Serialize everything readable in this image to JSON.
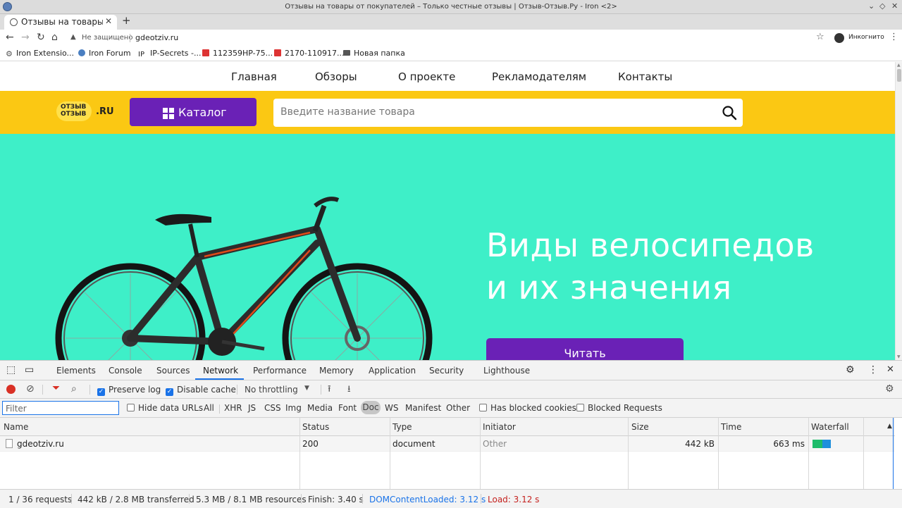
{
  "window": {
    "title": "Отзывы на товары от покупателей – Только честные отзывы | Отзыв-Отзыв.Ру - Iron <2>"
  },
  "tab": {
    "label": "Отзывы на товары от"
  },
  "addressbar": {
    "security": "Не защищено",
    "url": "gdeotziv.ru",
    "incognito": "Инкогнито"
  },
  "bookmarks": [
    "Iron Extensio...",
    "Iron Forum",
    "IP-Secrets -...",
    "112359HP-75...",
    "2170-110917...",
    "Новая папка"
  ],
  "site": {
    "nav": [
      "Главная",
      "Обзоры",
      "О проекте",
      "Рекламодателям",
      "Контакты"
    ],
    "logo_top": "ОТЗЫВ",
    "logo_bottom": "ОТЗЫВ",
    "logo_suffix": ".RU",
    "catalog_label": "Каталог",
    "search_placeholder": "Введите название товара",
    "hero_title_1": "Виды велосипедов",
    "hero_title_2": "и их значения",
    "read_button": "Читать"
  },
  "devtools": {
    "tabs": [
      "Elements",
      "Console",
      "Sources",
      "Network",
      "Performance",
      "Memory",
      "Application",
      "Security",
      "Lighthouse"
    ],
    "active_tab": "Network",
    "preserve_log": "Preserve log",
    "disable_cache": "Disable cache",
    "throttling": "No throttling",
    "filter_placeholder": "Filter",
    "hide_data_urls": "Hide data URLs",
    "type_filters": [
      "All",
      "XHR",
      "JS",
      "CSS",
      "Img",
      "Media",
      "Font",
      "Doc",
      "WS",
      "Manifest",
      "Other"
    ],
    "has_blocked_cookies": "Has blocked cookies",
    "blocked_requests": "Blocked Requests",
    "columns": [
      "Name",
      "Status",
      "Type",
      "Initiator",
      "Size",
      "Time",
      "Waterfall"
    ],
    "rows": [
      {
        "name": "gdeotziv.ru",
        "status": "200",
        "type": "document",
        "initiator": "Other",
        "size": "442 kB",
        "time": "663 ms"
      }
    ],
    "status": {
      "requests": "1 / 36 requests",
      "transferred": "442 kB / 2.8 MB transferred",
      "resources": "5.3 MB / 8.1 MB resources",
      "finish": "Finish: 3.40 s",
      "dom": "DOMContentLoaded: 3.12 s",
      "load": "Load: 3.12 s"
    }
  },
  "colors": {
    "brand_yellow": "#fbc813",
    "brand_purple": "#6a21b6",
    "hero_teal": "#3eefc8",
    "dom_blue": "#1a73e8",
    "load_red": "#c5221f"
  }
}
